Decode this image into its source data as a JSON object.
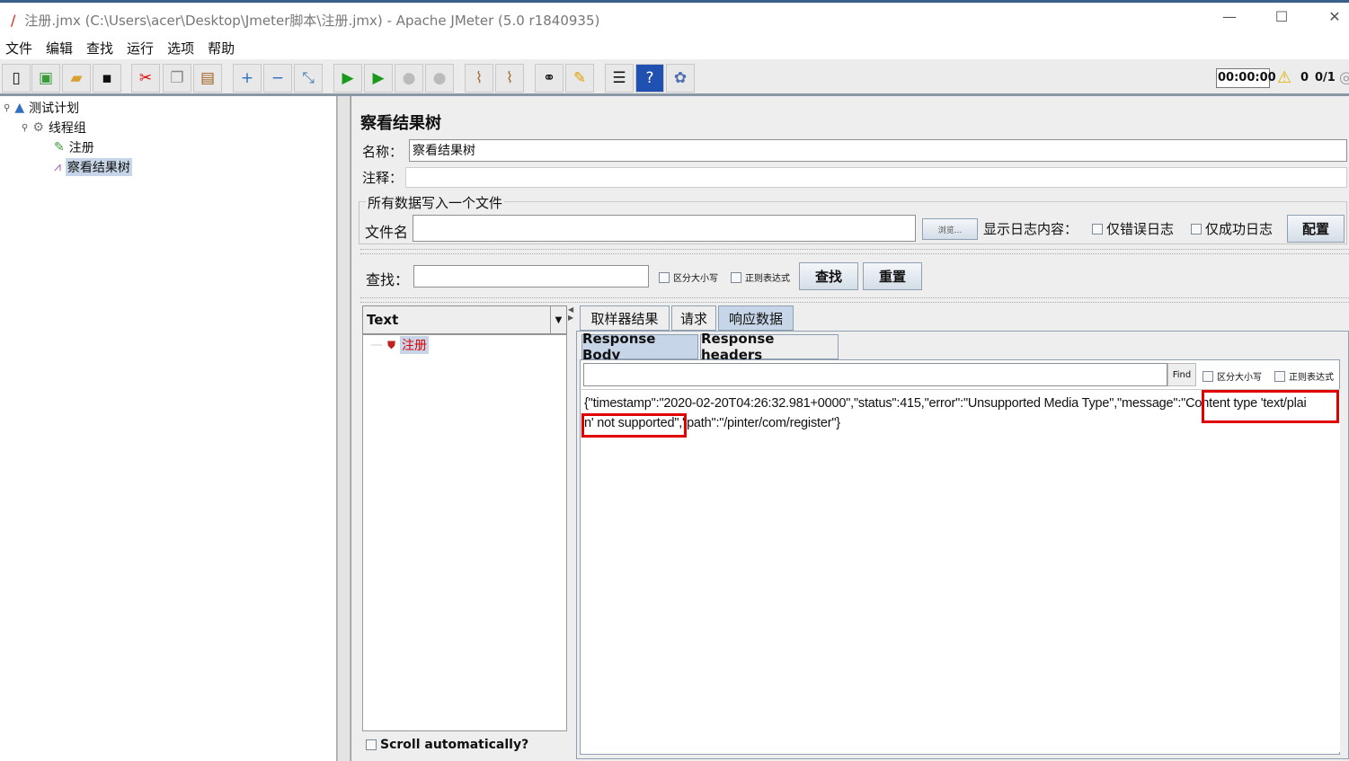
{
  "window": {
    "title": "注册.jmx (C:\\Users\\acer\\Desktop\\Jmeter脚本\\注册.jmx) - Apache JMeter (5.0 r1840935)",
    "minimize": "—",
    "maximize": "☐",
    "close": "✕"
  },
  "menu": [
    "文件",
    "编辑",
    "查找",
    "运行",
    "选项",
    "帮助"
  ],
  "toolbar": {
    "timer": "00:00:00",
    "warnings": "0",
    "threads": "0/1",
    "icons": [
      "new-icon",
      "templates-icon",
      "open-icon",
      "save-icon",
      "cut-icon",
      "copy-icon",
      "paste-icon",
      "expand-icon",
      "collapse-icon",
      "toggle-icon",
      "start-icon",
      "start-no-pause-icon",
      "stop-icon",
      "shutdown-icon",
      "clear-icon",
      "clear-all-icon",
      "search-icon",
      "reset-search-icon",
      "function-helper-icon",
      "help-icon",
      "logger-icon"
    ]
  },
  "tree": {
    "items": [
      {
        "label": "测试计划"
      },
      {
        "label": "线程组"
      },
      {
        "label": "注册"
      },
      {
        "label": "察看结果树"
      }
    ]
  },
  "panel": {
    "title": "察看结果树",
    "name_label": "名称：",
    "name_value": "察看结果树",
    "comments_label": "注释：",
    "comments_value": "",
    "file_group": "所有数据写入一个文件",
    "file_label": "文件名",
    "file_value": "",
    "browse": "浏览...",
    "log_label": "显示日志内容：",
    "errors_only": "仅错误日志",
    "success_only": "仅成功日志",
    "configure": "配置",
    "search_label": "查找：",
    "search_value": "",
    "case_sensitive": "区分大小写",
    "regex": "正则表达式",
    "find_btn": "查找",
    "reset_btn": "重置"
  },
  "results": {
    "renderer": "Text",
    "samples": [
      {
        "label": "注册",
        "status": "error"
      }
    ],
    "scroll_auto": "Scroll automatically?",
    "tabs": [
      "取样器结果",
      "请求",
      "响应数据"
    ],
    "active_tab": "响应数据",
    "subtabs": [
      "Response Body",
      "Response headers"
    ],
    "active_subtab": "Response Body",
    "find_value": "",
    "find_btn": "Find",
    "case_sensitive": "区分大小写",
    "regex": "正则表达式",
    "body_line1_a": "{\"timestamp\":\"2020-02-20T04:26:32.981+0000\",\"status\":415,\"error\":\"Unsupported Media Type\",\"message\":\"",
    "body_line1_b": "Content type 'text/plai",
    "body_line2_a": "n' not supported\"",
    "body_line2_b": ",\"path\":\"/pinter/com/register\"}"
  },
  "colors": {
    "highlight": "#e00000",
    "selection": "#c6d6e8",
    "error_text": "#e00000"
  }
}
